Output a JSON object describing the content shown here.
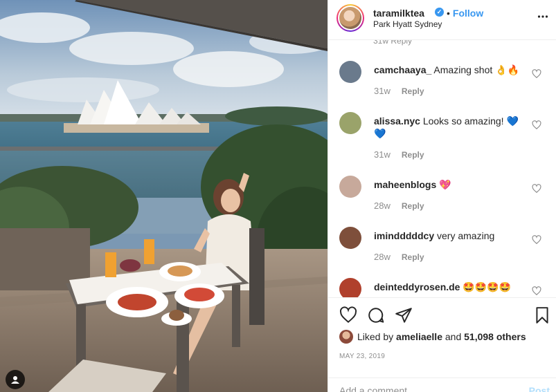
{
  "post": {
    "username": "taramilktea",
    "verified_mark": "✓",
    "separator": "•",
    "follow_label": "Follow",
    "location": "Park Hyatt Sydney",
    "more_icon": "more-horizontal-icon"
  },
  "comments_peek": "31w    Reply",
  "comments": [
    {
      "user": "camchaaya_",
      "text": "Amazing shot 👌🔥",
      "age": "31w",
      "reply_label": "Reply",
      "avatar_color": "#6a7a8c"
    },
    {
      "user": "alissa.nyc",
      "text": "Looks so amazing! 💙 💙",
      "age": "31w",
      "reply_label": "Reply",
      "avatar_color": "#9aa36a"
    },
    {
      "user": "maheenblogs",
      "text": "💖",
      "age": "28w",
      "reply_label": "Reply",
      "avatar_color": "#c7a99b"
    },
    {
      "user": "imindddddcy",
      "text": "very amazing",
      "age": "28w",
      "reply_label": "Reply",
      "avatar_color": "#7e4f3b"
    },
    {
      "user": "deinteddyrosen.de",
      "text": "🤩🤩🤩🤩",
      "age": "",
      "reply_label": "",
      "avatar_color": "#b0402c"
    }
  ],
  "likes": {
    "prefix": "Liked by",
    "liker": "ameliaelle",
    "middle": "and",
    "count": "51,098 others"
  },
  "date": "MAY 23, 2019",
  "composer": {
    "placeholder": "Add a comment...",
    "post_label": "Post"
  },
  "colors": {
    "accent": "#3897f0",
    "muted": "#8e8e8e",
    "text": "#262626",
    "post_disabled": "#b2dffc"
  }
}
